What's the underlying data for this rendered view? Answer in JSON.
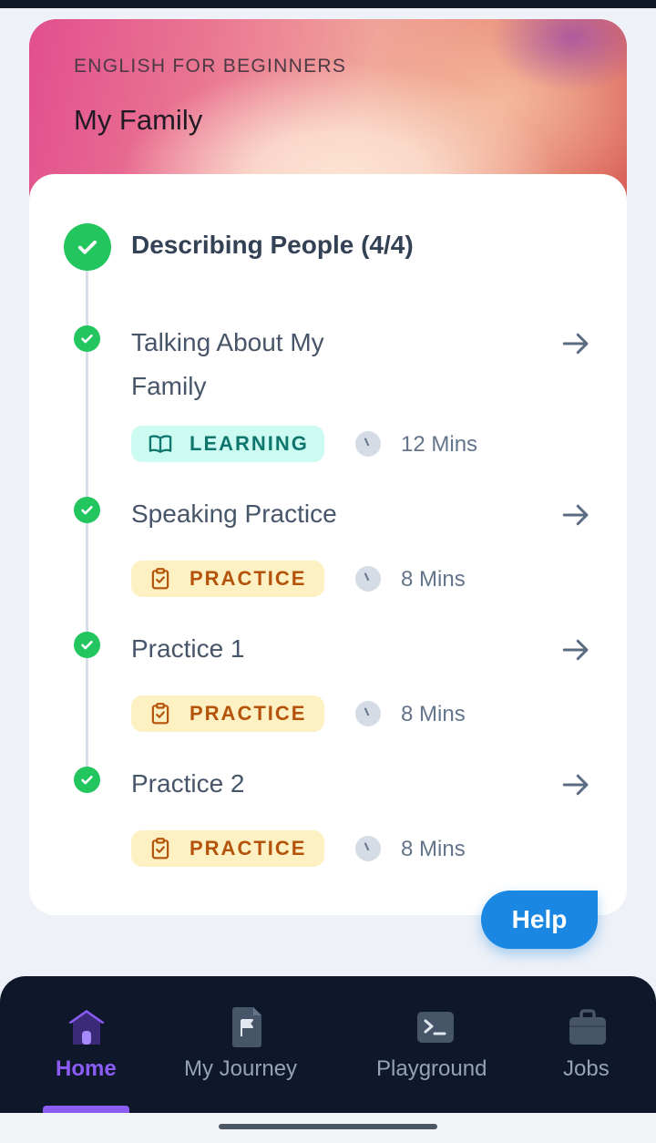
{
  "header": {
    "category": "ENGLISH FOR BEGINNERS",
    "title": "My Family"
  },
  "section": {
    "title": "Describing People (4/4)",
    "completed": true
  },
  "lessons": [
    {
      "title": "Talking About My Family",
      "tag": "LEARNING",
      "tag_icon": "book-open-icon",
      "duration": "12 Mins",
      "completed": true
    },
    {
      "title": "Speaking Practice",
      "tag": "PRACTICE",
      "tag_icon": "clipboard-check-icon",
      "duration": "8 Mins",
      "completed": true
    },
    {
      "title": "Practice 1",
      "tag": "PRACTICE",
      "tag_icon": "clipboard-check-icon",
      "duration": "8 Mins",
      "completed": true
    },
    {
      "title": "Practice 2",
      "tag": "PRACTICE",
      "tag_icon": "clipboard-check-icon",
      "duration": "8 Mins",
      "completed": true
    }
  ],
  "help": {
    "label": "Help"
  },
  "nav": {
    "items": [
      {
        "label": "Home",
        "icon": "home-icon",
        "active": true
      },
      {
        "label": "My Journey",
        "icon": "journey-flag-icon",
        "active": false
      },
      {
        "label": "Playground",
        "icon": "terminal-icon",
        "active": false
      },
      {
        "label": "Jobs",
        "icon": "briefcase-icon",
        "active": false
      }
    ]
  },
  "colors": {
    "check": "#22c55e",
    "accent": "#8b5cf6",
    "help": "#1a87e3",
    "learning_bg": "#ccfbf1",
    "practice_bg": "#fdf0c2"
  }
}
